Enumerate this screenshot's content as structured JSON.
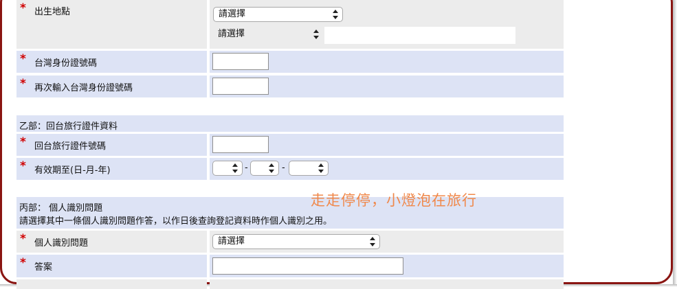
{
  "part_a_rows": {
    "birthplace": {
      "label": "出生地點",
      "select1": "請選擇",
      "select2": "請選擇"
    },
    "taiwan_id": {
      "label": "台灣身份證號碼"
    },
    "taiwan_id_confirm": {
      "label": "再次輸入台灣身份證號碼"
    }
  },
  "part_b": {
    "title": "乙部：回台旅行證件資料",
    "doc_number": {
      "label": "回台旅行證件號碼"
    },
    "expiry": {
      "label": "有效期至(日-月-年)",
      "separator": "-"
    }
  },
  "part_c": {
    "title": "丙部： 個人識別問題",
    "description": "請選擇其中一條個人識別問題作答，以作日後查詢登記資料時作個人識別之用。",
    "question": {
      "label": "個人識別問題",
      "select": "請選擇"
    },
    "answer": {
      "label": "答案"
    }
  },
  "required_marker": "*",
  "watermark": "走走停停，小燈泡在旅行",
  "colors": {
    "frame": "#8a1512",
    "required": "#d00000",
    "row_blue": "#dde3f5",
    "row_gray": "#ececec",
    "watermark": "#f0884a"
  }
}
